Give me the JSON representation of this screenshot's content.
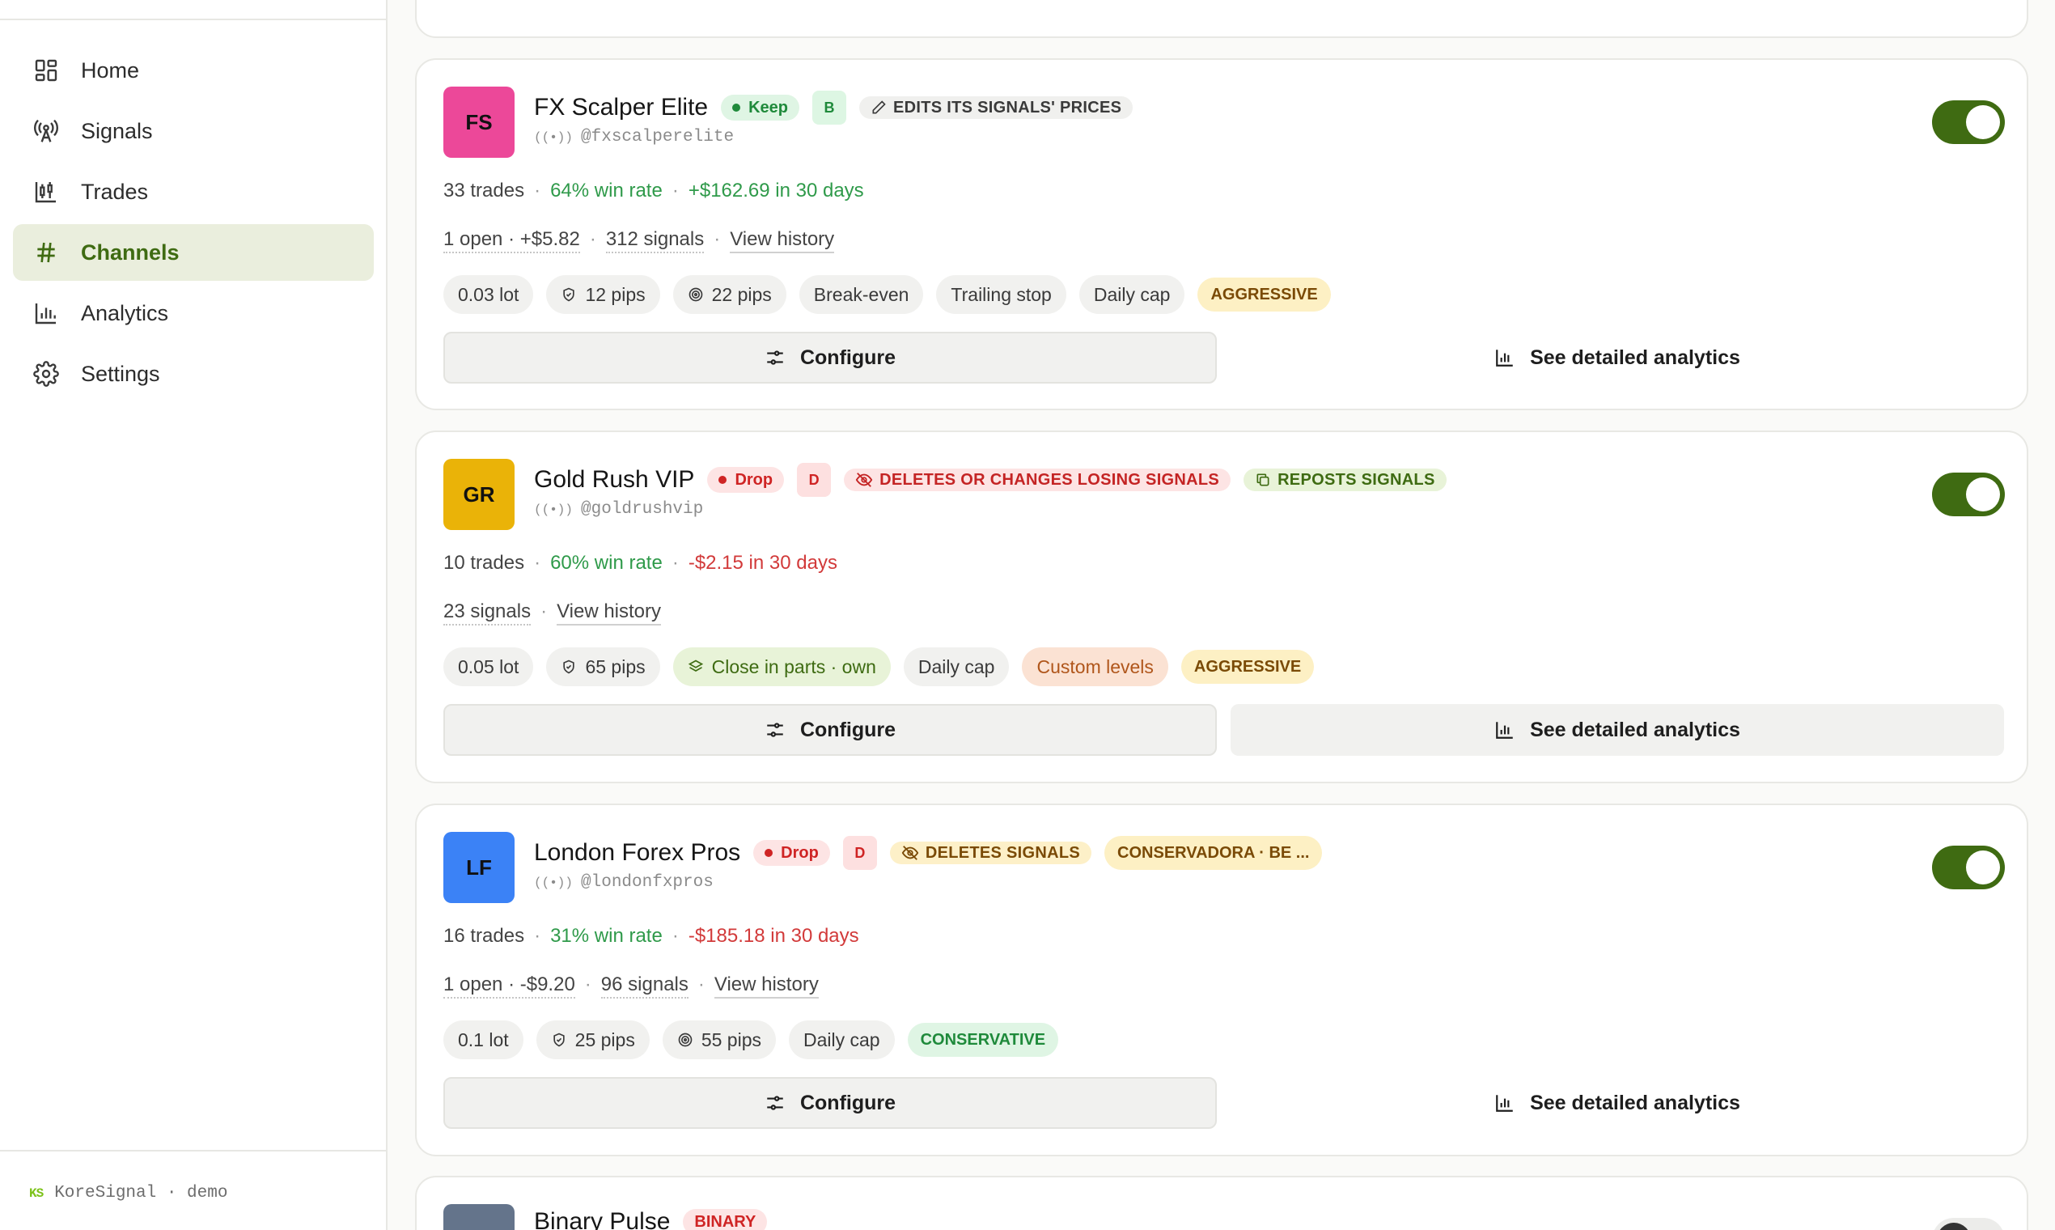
{
  "sidebar": {
    "items": [
      {
        "label": "Home",
        "icon": "grid-icon"
      },
      {
        "label": "Signals",
        "icon": "antenna-icon"
      },
      {
        "label": "Trades",
        "icon": "candlestick-icon"
      },
      {
        "label": "Channels",
        "icon": "hash-icon",
        "active": true
      },
      {
        "label": "Analytics",
        "icon": "bar-chart-icon"
      },
      {
        "label": "Settings",
        "icon": "gear-icon"
      }
    ],
    "footer": {
      "logo": "KS",
      "text": "KoreSignal · demo"
    }
  },
  "channels": [
    {
      "initials": "FS",
      "avatar_color": "#ec4899",
      "name": "FX Scalper Elite",
      "handle": "@fxscalperelite",
      "verdict": "Keep",
      "grade": "B",
      "flags": [
        "EDITS ITS SIGNALS' PRICES"
      ],
      "trades": "33 trades",
      "win_rate": "64% win rate",
      "pnl": "+$162.69 in 30 days",
      "open": "1 open · +$5.82",
      "signals": "312 signals",
      "history": "View history",
      "chips": [
        "0.03 lot",
        "12 pips",
        "22 pips",
        "Break-even",
        "Trailing stop",
        "Daily cap"
      ],
      "risk": "AGGRESSIVE",
      "configure": "Configure",
      "analytics": "See detailed analytics",
      "enabled": true
    },
    {
      "initials": "GR",
      "avatar_color": "#eab308",
      "name": "Gold Rush VIP",
      "handle": "@goldrushvip",
      "verdict": "Drop",
      "grade": "D",
      "flags": [
        "DELETES OR CHANGES LOSING SIGNALS",
        "REPOSTS SIGNALS"
      ],
      "trades": "10 trades",
      "win_rate": "60% win rate",
      "pnl": "-$2.15 in 30 days",
      "signals": "23 signals",
      "history": "View history",
      "chips": [
        "0.05 lot",
        "65 pips",
        "Close in parts · own",
        "Daily cap",
        "Custom levels"
      ],
      "risk": "AGGRESSIVE",
      "configure": "Configure",
      "analytics": "See detailed analytics",
      "enabled": true
    },
    {
      "initials": "LF",
      "avatar_color": "#3b82f6",
      "name": "London Forex Pros",
      "handle": "@londonfxpros",
      "verdict": "Drop",
      "grade": "D",
      "flags": [
        "DELETES SIGNALS",
        "CONSERVADORA · BE ..."
      ],
      "trades": "16 trades",
      "win_rate": "31% win rate",
      "pnl": "-$185.18 in 30 days",
      "open": "1 open · -$9.20",
      "signals": "96 signals",
      "history": "View history",
      "chips": [
        "0.1 lot",
        "25 pips",
        "55 pips",
        "Daily cap"
      ],
      "risk": "CONSERVATIVE",
      "configure": "Configure",
      "analytics": "See detailed analytics",
      "enabled": true
    },
    {
      "name": "Binary Pulse",
      "badge": "BINARY",
      "avatar_color": "#64748b",
      "enabled": false
    }
  ]
}
